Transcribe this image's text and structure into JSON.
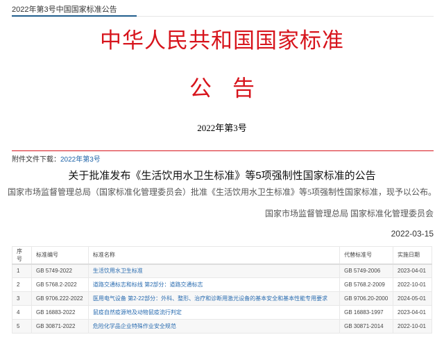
{
  "breadcrumb": "2022年第3号中国国家标准公告",
  "title": "中华人民共和国国家标准",
  "subtitle": "公告",
  "number": "2022年第3号",
  "attachment": {
    "label": "附件文件下载：",
    "link": "2022年第3号"
  },
  "headline": "关于批准发布《生活饮用水卫生标准》等5项强制性国家标准的公告",
  "body": "国家市场监督管理总局（国家标准化管理委员会）批准《生活饮用水卫生标准》等5项强制性国家标准，现予以公布。",
  "signature": "国家市场监督管理总局 国家标准化管理委员会",
  "date": "2022-03-15",
  "table": {
    "headers": [
      "序号",
      "标准编号",
      "标准名称",
      "代替标准号",
      "实施日期"
    ],
    "rows": [
      [
        "1",
        "GB 5749-2022",
        "生活饮用水卫生标准",
        "GB 5749-2006",
        "2023-04-01"
      ],
      [
        "2",
        "GB 5768.2-2022",
        "道路交通标志和标线 第2部分：道路交通标志",
        "GB 5768.2-2009",
        "2022-10-01"
      ],
      [
        "3",
        "GB 9706.222-2022",
        "医用电气设备 第2-22部分：外科、整形、治疗和诊断用激光设备的基本安全和基本性能专用要求",
        "GB 9706.20-2000",
        "2024-05-01"
      ],
      [
        "4",
        "GB 16883-2022",
        "鼠疫自然疫源地及动物鼠疫流行判定",
        "GB 16883-1997",
        "2023-04-01"
      ],
      [
        "5",
        "GB 30871-2022",
        "危险化学品企业特殊作业安全规范",
        "GB 30871-2014",
        "2022-10-01"
      ]
    ]
  }
}
